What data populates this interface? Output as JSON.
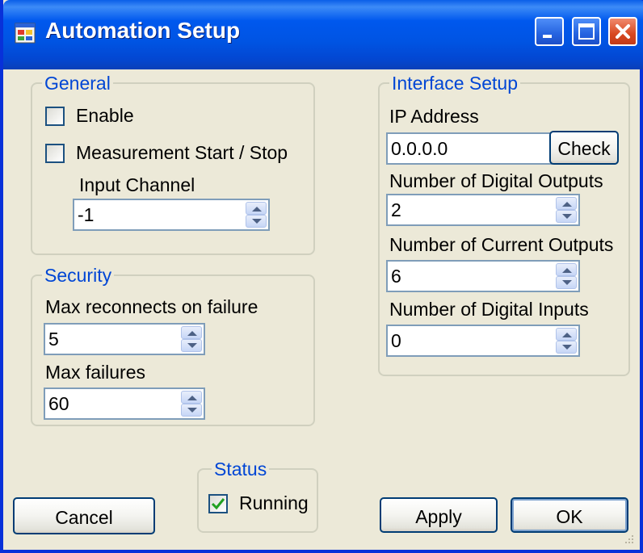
{
  "window": {
    "title": "Automation Setup",
    "icon": "app-window-icon",
    "controls": [
      "minimize-icon",
      "maximize-icon",
      "close-icon"
    ]
  },
  "general": {
    "legend": "General",
    "enable_label": "Enable",
    "enable_checked": false,
    "measure_label": "Measurement Start / Stop",
    "measure_checked": false,
    "input_channel_label": "Input Channel",
    "input_channel_value": "-1"
  },
  "security": {
    "legend": "Security",
    "max_reconnects_label": "Max reconnects on failure",
    "max_reconnects_value": "5",
    "max_failures_label": "Max failures",
    "max_failures_value": "60"
  },
  "interface": {
    "legend": "Interface Setup",
    "ip_label": "IP Address",
    "ip_value": "0.0.0.0",
    "check_label": "Check",
    "digital_outputs_label": "Number of Digital Outputs",
    "digital_outputs_value": "2",
    "current_outputs_label": "Number of Current Outputs",
    "current_outputs_value": "6",
    "digital_inputs_label": "Number of Digital Inputs",
    "digital_inputs_value": "0"
  },
  "status": {
    "legend": "Status",
    "running_label": "Running",
    "running_checked": true
  },
  "buttons": {
    "cancel": "Cancel",
    "apply": "Apply",
    "ok": "OK"
  },
  "colors": {
    "titlebar": "#0054e3",
    "group_legend": "#0046d5",
    "dialog_bg": "#ece9d8",
    "check_mark": "#21a121"
  }
}
